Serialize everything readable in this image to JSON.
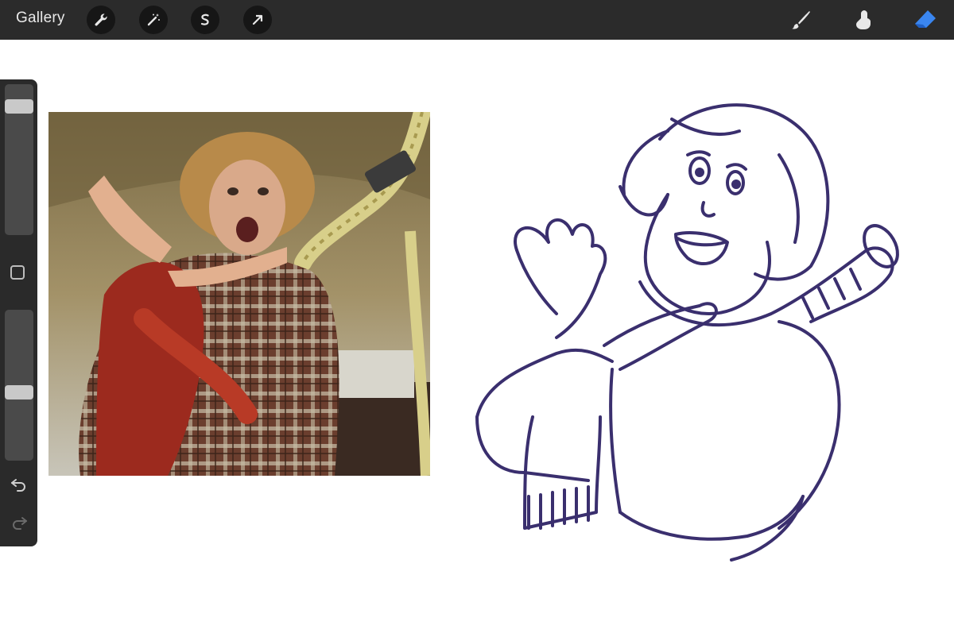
{
  "toolbar": {
    "gallery_label": "Gallery",
    "left_tools": [
      "wrench-icon",
      "magic-wand-icon",
      "selection-icon",
      "transform-arrow-icon"
    ],
    "right_tools": [
      "brush-icon",
      "smudge-icon",
      "eraser-icon"
    ],
    "active_tool": "eraser-icon",
    "accent_color": "#3a86f0"
  },
  "sidebar": {
    "brush_size_level": 0.11,
    "opacity_level": 0.55,
    "controls": [
      "modify-square-icon",
      "undo-icon",
      "redo-icon"
    ]
  },
  "canvas": {
    "background": "#ffffff",
    "stroke_color": "#3a2f6e"
  }
}
